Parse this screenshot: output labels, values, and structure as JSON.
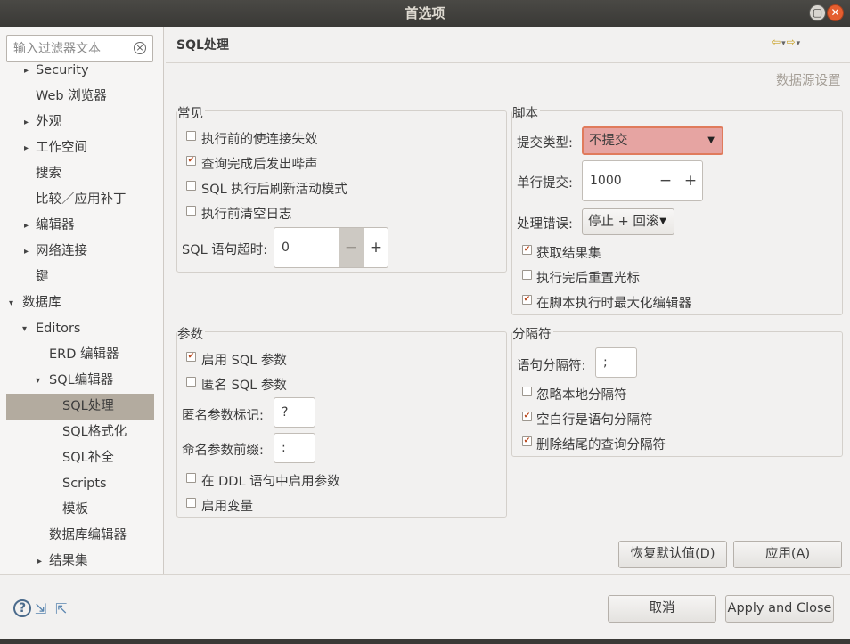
{
  "window": {
    "title": "首选项",
    "maximize_glyph": "▢",
    "close_glyph": "✕"
  },
  "sidebar": {
    "filter_placeholder": "输入过滤器文本",
    "clear_glyph": "×",
    "items": [
      {
        "label": "Security",
        "arrow": "▸"
      },
      {
        "label": "Web 浏览器",
        "arrow": ""
      },
      {
        "label": "外观",
        "arrow": "▸"
      },
      {
        "label": "工作空间",
        "arrow": "▸"
      },
      {
        "label": "搜索",
        "arrow": ""
      },
      {
        "label": "比较／应用补丁",
        "arrow": ""
      },
      {
        "label": "编辑器",
        "arrow": "▸"
      },
      {
        "label": "网络连接",
        "arrow": "▸"
      },
      {
        "label": "键",
        "arrow": ""
      },
      {
        "label": "数据库",
        "arrow": "▾"
      },
      {
        "label": "Editors",
        "arrow": "▾"
      },
      {
        "label": "ERD 编辑器",
        "arrow": ""
      },
      {
        "label": "SQL编辑器",
        "arrow": "▾"
      },
      {
        "label": "SQL处理",
        "arrow": ""
      },
      {
        "label": "SQL格式化",
        "arrow": ""
      },
      {
        "label": "SQL补全",
        "arrow": ""
      },
      {
        "label": "Scripts",
        "arrow": ""
      },
      {
        "label": "模板",
        "arrow": ""
      },
      {
        "label": "数据库编辑器",
        "arrow": ""
      },
      {
        "label": "结果集",
        "arrow": "▸"
      }
    ]
  },
  "page": {
    "title": "SQL处理",
    "nav_icons": {
      "back": "⇦",
      "forward": "⇨",
      "menu": "▾"
    },
    "datasource_link": "数据源设置"
  },
  "common": {
    "title": "常见",
    "options": [
      {
        "label": "执行前的使连接失效",
        "checked": false
      },
      {
        "label": "查询完成后发出哔声",
        "checked": true
      },
      {
        "label": "SQL 执行后刷新活动模式",
        "checked": false
      },
      {
        "label": "执行前清空日志",
        "checked": false
      }
    ],
    "timeout_label": "SQL 语句超时:",
    "timeout_value": "0",
    "minus": "−",
    "plus": "+"
  },
  "script": {
    "title": "脚本",
    "commit_type_label": "提交类型:",
    "commit_type_value": "不提交",
    "commit_lines_label": "单行提交:",
    "commit_lines_value": "1000",
    "minus": "−",
    "plus": "+",
    "error_label": "处理错误:",
    "error_value": "停止 + 回滚",
    "options": [
      {
        "label": "获取结果集",
        "checked": true
      },
      {
        "label": "执行完后重置光标",
        "checked": false
      },
      {
        "label": "在脚本执行时最大化编辑器",
        "checked": true
      }
    ]
  },
  "params": {
    "title": "参数",
    "enable_sql_params": {
      "label": "启用 SQL 参数",
      "checked": true
    },
    "anonymous_sql_params": {
      "label": "匿名 SQL 参数",
      "checked": false
    },
    "anon_marker_label": "匿名参数标记:",
    "anon_marker_value": "?",
    "named_prefix_label": "命名参数前缀:",
    "named_prefix_value": ":",
    "ddl_params": {
      "label": "在 DDL 语句中启用参数",
      "checked": false
    },
    "variables": {
      "label": "启用变量",
      "checked": false
    }
  },
  "delimiter": {
    "title": "分隔符",
    "stmt_delim_label": "语句分隔符:",
    "stmt_delim_value": ";",
    "options": [
      {
        "label": "忽略本地分隔符",
        "checked": false
      },
      {
        "label": "空白行是语句分隔符",
        "checked": true
      },
      {
        "label": "删除结尾的查询分隔符",
        "checked": true
      }
    ]
  },
  "buttons": {
    "restore_defaults": "恢复默认值(D)",
    "apply": "应用(A)",
    "cancel": "取消",
    "apply_close": "Apply and Close"
  },
  "footer_icons": {
    "help": "?",
    "import": "⇲",
    "export": "⇱"
  }
}
